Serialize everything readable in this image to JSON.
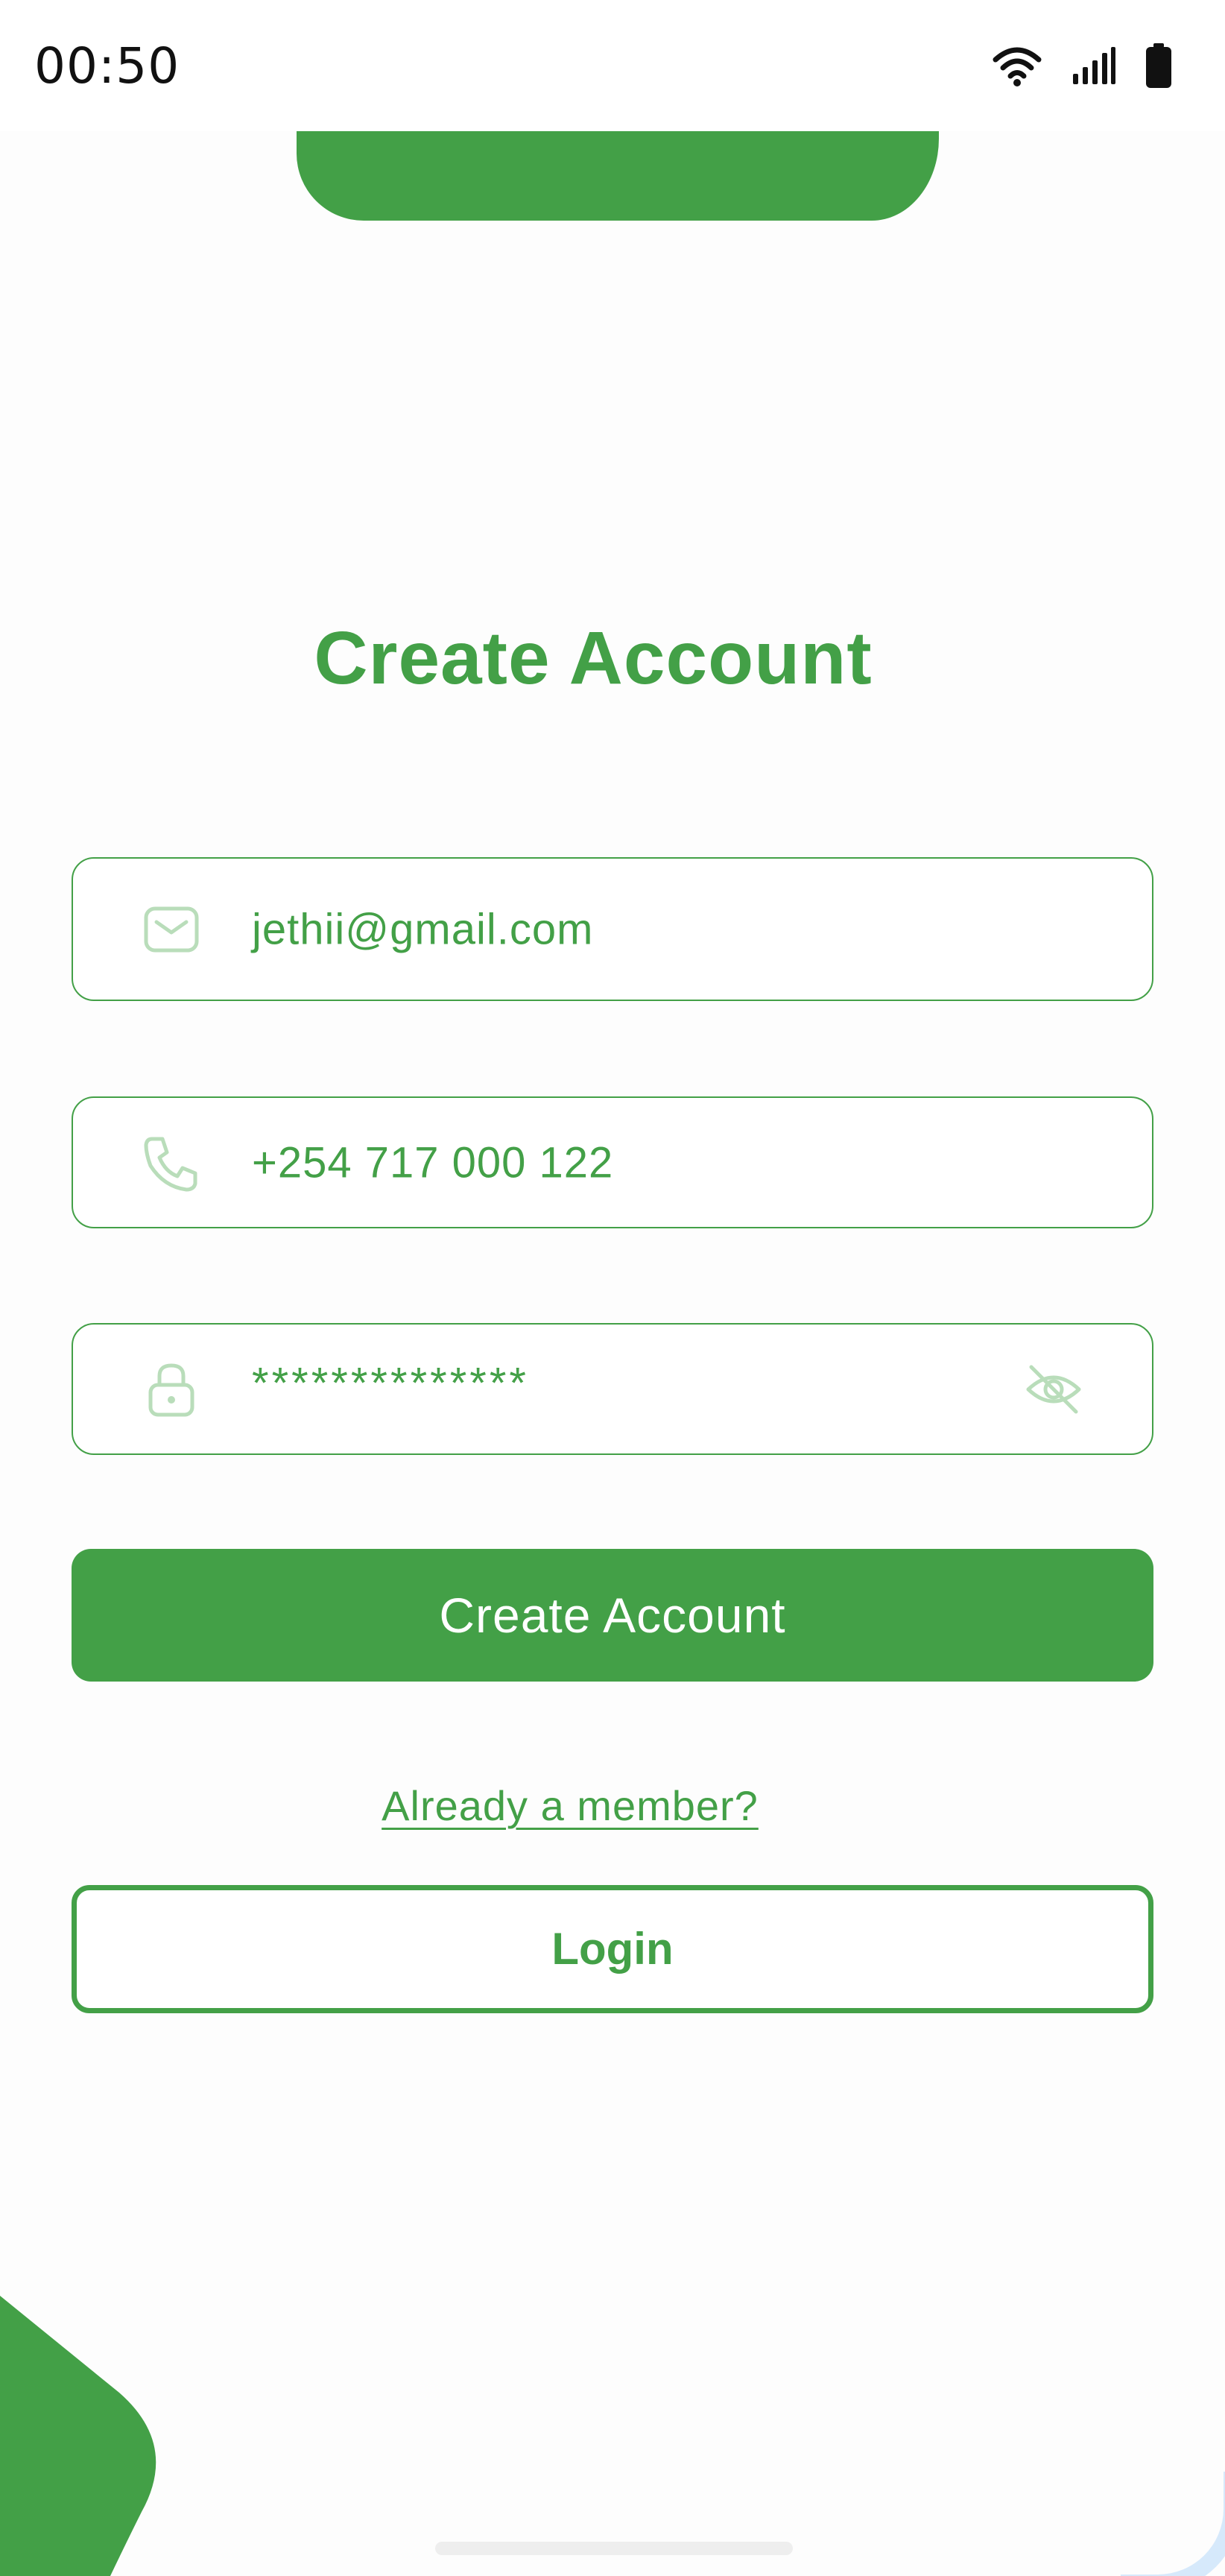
{
  "status_bar": {
    "time": "00:50",
    "icons": [
      "wifi-icon",
      "cellular-signal-icon",
      "battery-icon"
    ]
  },
  "colors": {
    "accent": "#43A047",
    "icon_muted": "#B9DDBA",
    "corner_blue": "#D6E9FB"
  },
  "form": {
    "title": "Create Account",
    "email": {
      "value": "jethii@gmail.com",
      "icon": "mail-icon"
    },
    "phone": {
      "value": "+254 717 000 122",
      "icon": "phone-icon"
    },
    "password": {
      "value": "**************",
      "icon": "lock-icon",
      "toggle_icon": "eye-off-icon"
    },
    "submit_label": "Create Account",
    "member_link": "Already a member?",
    "login_label": "Login"
  }
}
